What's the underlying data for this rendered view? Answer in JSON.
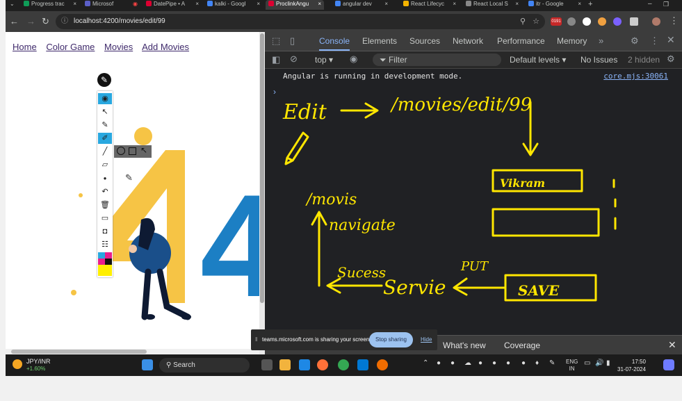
{
  "browser": {
    "tabs": [
      {
        "label": "Progress trac",
        "color": "#0f9d58"
      },
      {
        "label": "Microsof",
        "color": "#5b5fc7"
      },
      {
        "label": "DatePipe • A",
        "color": "#dd0031"
      },
      {
        "label": "kalki - Googl",
        "color": "#4285f4"
      },
      {
        "label": "ProclinkAngu",
        "color": "#dd0031"
      },
      {
        "label": "angular dev",
        "color": "#4285f4"
      },
      {
        "label": "React Lifecyc",
        "color": "#f4b400"
      },
      {
        "label": "React Local S",
        "color": "#888888"
      },
      {
        "label": "itr - Google",
        "color": "#4285f4"
      }
    ],
    "url": "localhost:4200/movies/edit/99",
    "badge": "0191"
  },
  "app": {
    "nav": {
      "home": "Home",
      "color_game": "Color Game",
      "movies": "Movies",
      "add_movies": "Add Movies"
    },
    "illustration_text": "40"
  },
  "devtools": {
    "tabs": {
      "console": "Console",
      "elements": "Elements",
      "sources": "Sources",
      "network": "Network",
      "performance": "Performance",
      "memory": "Memory"
    },
    "context": "top",
    "filter_placeholder": "Filter",
    "levels": "Default levels",
    "issues": "No Issues",
    "hidden": "2 hidden",
    "log_message": "Angular is running in development mode.",
    "log_source": "core.mjs:30061",
    "drawer": {
      "whats_new": "What's new",
      "coverage": "Coverage"
    }
  },
  "annotation": {
    "edit": "Edit",
    "route": "/movies/edit/99",
    "input_value": "Vikram",
    "movies": "/movis",
    "navigate": "navigate",
    "success": "Sucess",
    "service": "Servie",
    "put": "PUT",
    "save": "SAVE"
  },
  "share": {
    "text": "teams.microsoft.com is sharing your screen.",
    "stop": "Stop sharing",
    "hide": "Hide"
  },
  "taskbar": {
    "ticker": "JPY/INR",
    "change": "+1.60%",
    "search": "Search",
    "lang1": "ENG",
    "lang2": "IN",
    "time": "17:50",
    "date": "31-07-2024"
  }
}
